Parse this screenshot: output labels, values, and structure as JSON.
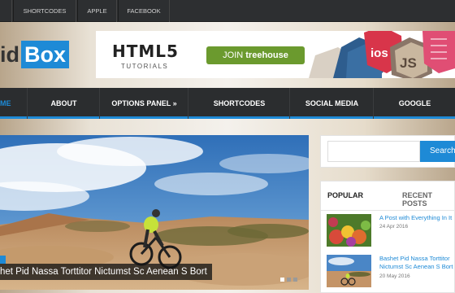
{
  "topbar": {
    "links": [
      "",
      "Shortcodes",
      "Apple",
      "Facebook"
    ]
  },
  "logo": {
    "part1": "id",
    "part2": "Box"
  },
  "banner": {
    "title": "HTML5",
    "subtitle": "TUTORIALS",
    "join_prefix": "JOIN",
    "join_brand": "treehouse",
    "badges": [
      "ios",
      "JS"
    ]
  },
  "nav": {
    "items": [
      "ME",
      "About",
      "Options Panel »",
      "Shortcodes",
      "Social Media",
      "Google"
    ],
    "active_index": 0
  },
  "slider": {
    "caption": "het Pid Nassa Torttitor Nictumst Sc Aenean S Bort",
    "slide_count": 3,
    "active_slide": 1
  },
  "sidebar": {
    "search": {
      "placeholder": "",
      "button_label": "Search"
    },
    "tabs": [
      "Popular",
      "Recent Posts"
    ],
    "posts": [
      {
        "title": "A Post with Everything In It",
        "date": "24 Apr 2016"
      },
      {
        "title": "Bashet Pid Nassa Torttitor Nictumst Sc Aenean S Bort",
        "date": "20 May 2016"
      }
    ]
  },
  "colors": {
    "accent": "#1e8ad6",
    "nav_bg": "#2b2d2f",
    "topbar_bg": "#2d2f31"
  }
}
